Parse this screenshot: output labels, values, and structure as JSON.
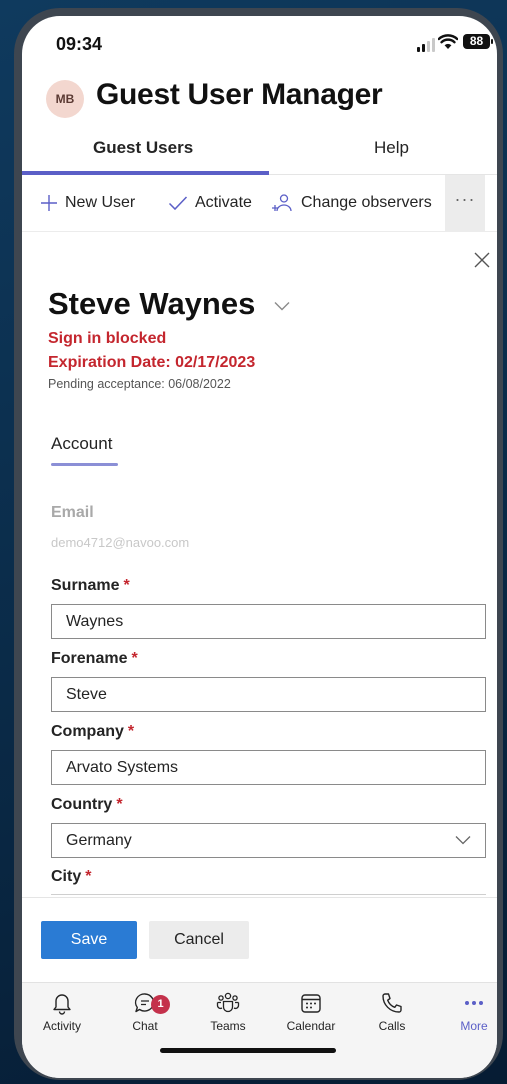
{
  "status_bar": {
    "time": "09:34",
    "battery": "88"
  },
  "app": {
    "avatar_initials": "MB",
    "title": "Guest User Manager"
  },
  "tabs": [
    {
      "label": "Guest Users",
      "active": true
    },
    {
      "label": "Help",
      "active": false
    }
  ],
  "toolbar": {
    "new_user": "New User",
    "activate": "Activate",
    "change_observers": "Change observers",
    "more": "···"
  },
  "person": {
    "name": "Steve Waynes",
    "sign_in_status": "Sign in blocked",
    "expiration": "Expiration Date: 02/17/2023",
    "pending": "Pending acceptance: 06/08/2022"
  },
  "section_tab": "Account",
  "form": {
    "email": {
      "label": "Email",
      "value": "demo4712@navoo.com"
    },
    "surname": {
      "label": "Surname",
      "required": "*",
      "value": "Waynes"
    },
    "forename": {
      "label": "Forename",
      "required": "*",
      "value": "Steve"
    },
    "company": {
      "label": "Company",
      "required": "*",
      "value": "Arvato Systems"
    },
    "country": {
      "label": "Country",
      "required": "*",
      "value": "Germany"
    },
    "city": {
      "label": "City",
      "required": "*"
    }
  },
  "actions": {
    "save": "Save",
    "cancel": "Cancel"
  },
  "nav": [
    {
      "label": "Activity",
      "icon": "bell-icon"
    },
    {
      "label": "Chat",
      "icon": "chat-icon",
      "badge": "1"
    },
    {
      "label": "Teams",
      "icon": "teams-icon"
    },
    {
      "label": "Calendar",
      "icon": "calendar-icon"
    },
    {
      "label": "Calls",
      "icon": "phone-icon"
    },
    {
      "label": "More",
      "icon": "more-icon",
      "active": true
    }
  ],
  "colors": {
    "accent": "#5b5fc7",
    "primary_button": "#2a7bd4",
    "error": "#c4262e",
    "badge": "#c4314b"
  }
}
